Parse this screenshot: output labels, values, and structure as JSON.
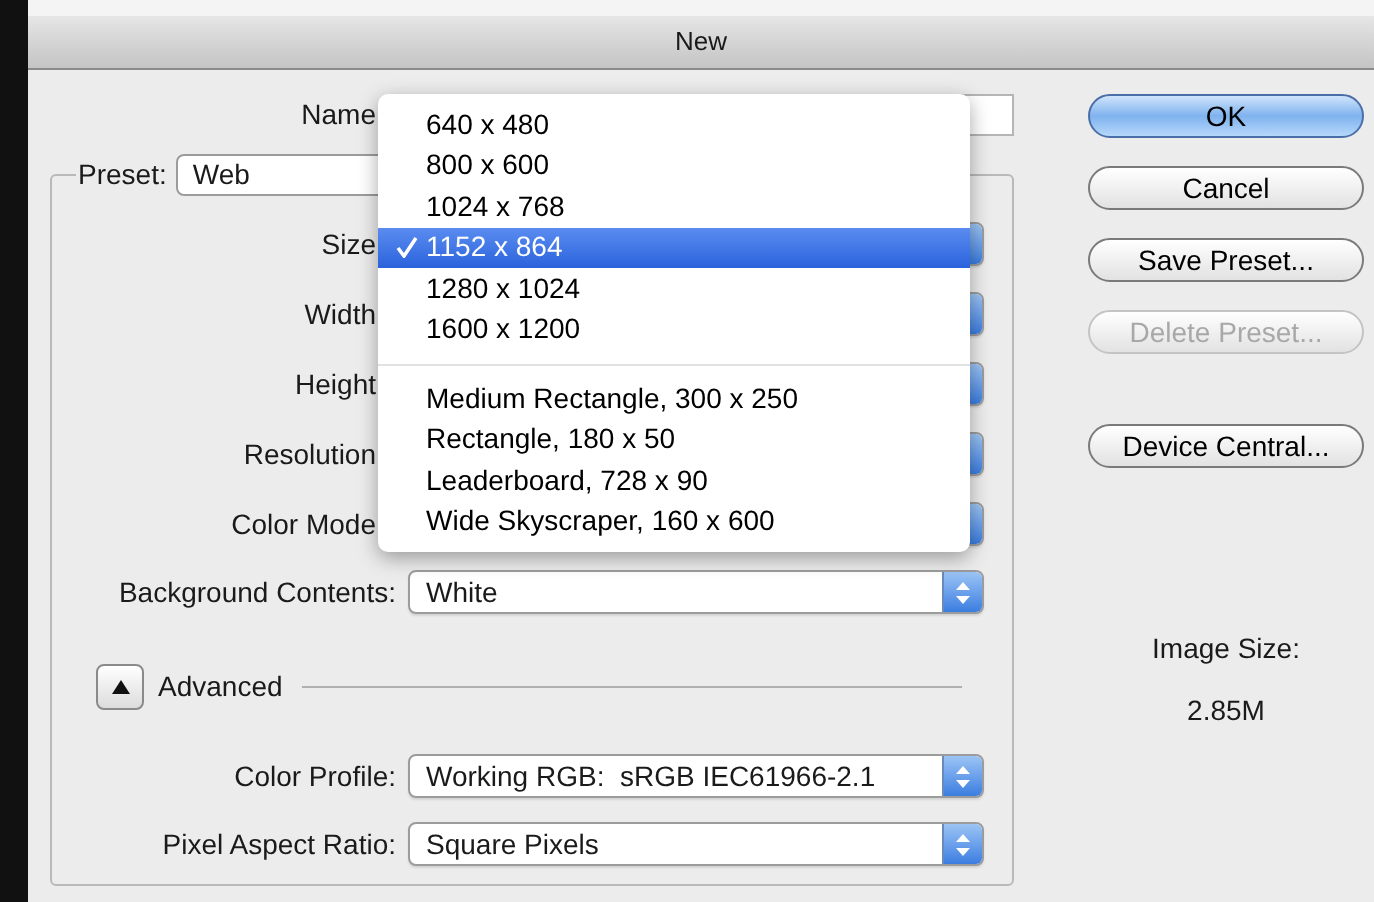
{
  "window": {
    "title": "New"
  },
  "name_field": {
    "label": "Name"
  },
  "preset": {
    "label": "Preset:",
    "value": "Web"
  },
  "covered_rows": [
    {
      "label": "Size"
    },
    {
      "label": "Width"
    },
    {
      "label": "Height"
    },
    {
      "label": "Resolution"
    },
    {
      "label": "Color Mode"
    }
  ],
  "background_contents": {
    "label": "Background Contents:",
    "value": "White"
  },
  "advanced": {
    "label": "Advanced",
    "expanded": true
  },
  "advanced_rows": [
    {
      "label": "Color Profile:",
      "value": "Working RGB:  sRGB IEC61966-2.1"
    },
    {
      "label": "Pixel Aspect Ratio:",
      "value": "Square Pixels"
    }
  ],
  "size_menu": {
    "items": [
      {
        "kind": "item",
        "label": "640 x 480",
        "selected": false
      },
      {
        "kind": "item",
        "label": "800 x 600",
        "selected": false
      },
      {
        "kind": "item",
        "label": "1024 x 768",
        "selected": false
      },
      {
        "kind": "item",
        "label": "1152 x 864",
        "selected": true
      },
      {
        "kind": "item",
        "label": "1280 x 1024",
        "selected": false
      },
      {
        "kind": "item",
        "label": "1600 x 1200",
        "selected": false
      },
      {
        "kind": "separator"
      },
      {
        "kind": "item",
        "label": "Medium Rectangle, 300 x 250",
        "selected": false
      },
      {
        "kind": "item",
        "label": "Rectangle, 180 x 50",
        "selected": false
      },
      {
        "kind": "item",
        "label": "Leaderboard, 728 x 90",
        "selected": false
      },
      {
        "kind": "item",
        "label": "Wide Skyscraper, 160 x 600",
        "selected": false
      }
    ]
  },
  "buttons": [
    {
      "label": "OK",
      "kind": "default",
      "disabled": false
    },
    {
      "label": "Cancel",
      "kind": "normal",
      "disabled": false
    },
    {
      "label": "Save Preset...",
      "kind": "normal",
      "disabled": false
    },
    {
      "label": "Delete Preset...",
      "kind": "normal",
      "disabled": true
    },
    {
      "label": "Device Central...",
      "kind": "normal",
      "disabled": false
    }
  ],
  "image_size": {
    "label": "Image Size:",
    "value": "2.85M"
  }
}
